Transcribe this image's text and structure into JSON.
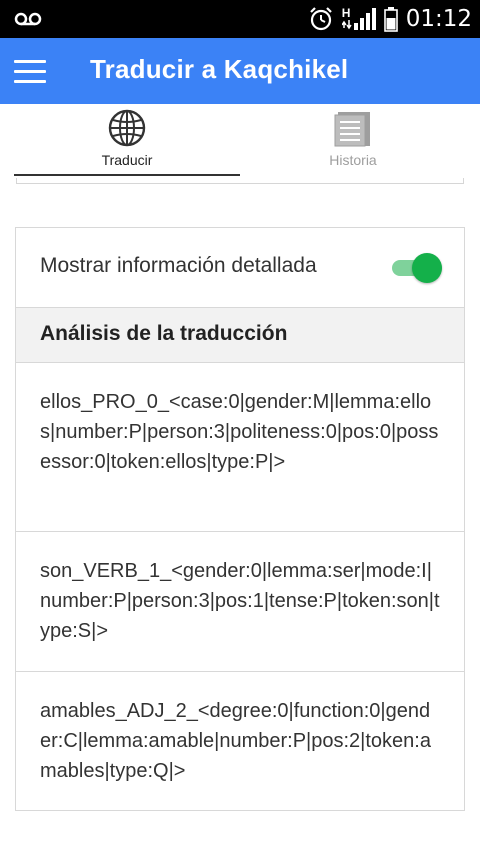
{
  "status_bar": {
    "time": "01:12",
    "icons": [
      "voicemail-icon",
      "alarm-icon",
      "h-network-icon",
      "signal-icon",
      "battery-icon"
    ],
    "network_label": "H"
  },
  "app_bar": {
    "title": "Traducir a Kaqchikel",
    "background": "#3b82f6",
    "menu_icon": "menu-icon"
  },
  "tabs": [
    {
      "label": "Traducir",
      "icon": "globe-icon",
      "active": true
    },
    {
      "label": "Historia",
      "icon": "history-list-icon",
      "active": false
    }
  ],
  "toggle": {
    "label": "Mostrar información detallada",
    "on": true,
    "accent": "#14b04a"
  },
  "analysis": {
    "title": "Análisis de la traducción",
    "items": [
      {
        "text": "ellos_PRO_0_<case:0|gender:M|lemma:ellos|number:P|person:3|politeness:0|pos:0|possessor:0|token:ellos|type:P|>"
      },
      {
        "text": "son_VERB_1_<gender:0|lemma:ser|mode:I|number:P|person:3|pos:1|tense:P|token:son|type:S|>"
      },
      {
        "text": "amables_ADJ_2_<degree:0|function:0|gender:C|lemma:amable|number:P|pos:2|token:amables|type:Q|>"
      }
    ]
  }
}
